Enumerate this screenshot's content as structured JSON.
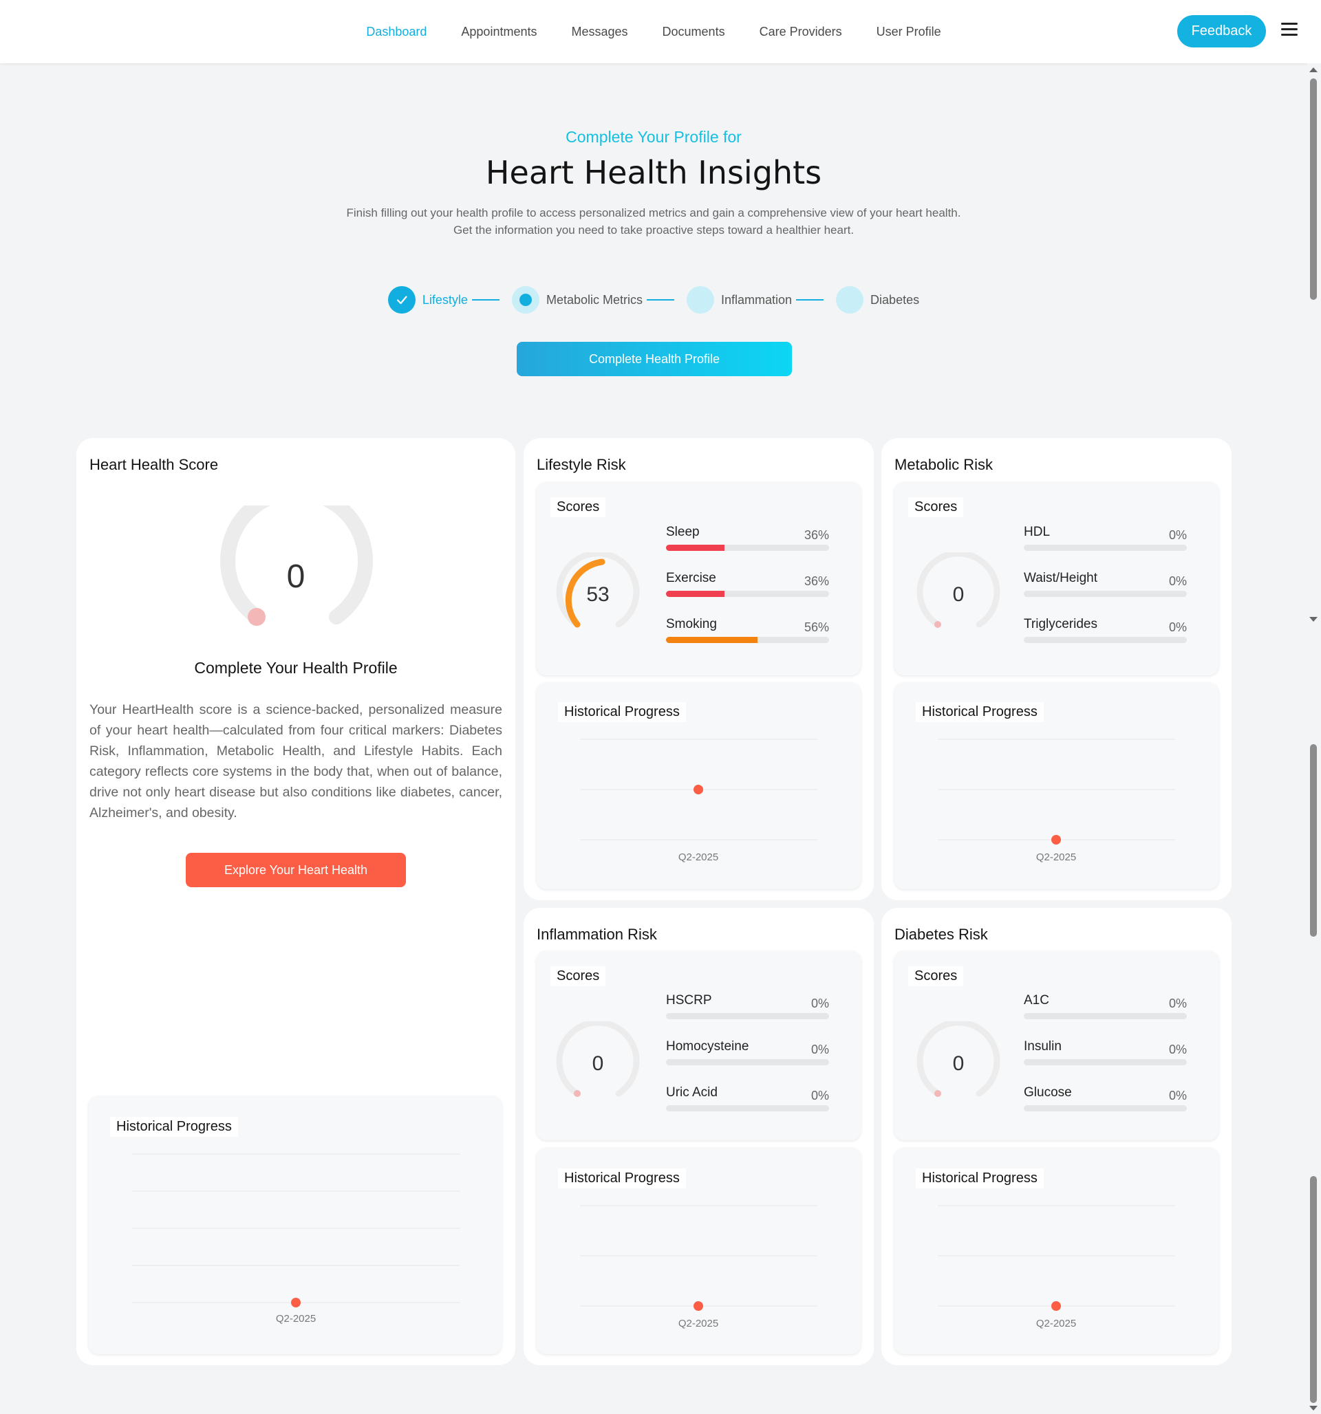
{
  "nav": {
    "items": [
      {
        "label": "Dashboard",
        "active": true
      },
      {
        "label": "Appointments",
        "active": false
      },
      {
        "label": "Messages",
        "active": false
      },
      {
        "label": "Documents",
        "active": false
      },
      {
        "label": "Care Providers",
        "active": false
      },
      {
        "label": "User Profile",
        "active": false
      }
    ],
    "feedback_label": "Feedback",
    "menu_icon": "hamburger-menu-icon"
  },
  "hero": {
    "subtitle": "Complete Your Profile for",
    "title": "Heart Health Insights",
    "description": "Finish filling out your health profile to access personalized metrics and gain a comprehensive view of your heart health. Get the information you need to take proactive steps toward a healthier heart.",
    "steps": [
      {
        "label": "Lifestyle",
        "state": "done"
      },
      {
        "label": "Metabolic Metrics",
        "state": "current"
      },
      {
        "label": "Inflammation",
        "state": "pending"
      },
      {
        "label": "Diabetes",
        "state": "pending"
      }
    ],
    "cta_label": "Complete Health Profile"
  },
  "colors": {
    "accent": "#13aee0",
    "red_bar": "#f0404f",
    "orange_bar": "#f4820f",
    "gauge_track": "#e9e9e9",
    "gauge_orange": "#f7931e",
    "dot": "#fb5e44",
    "cta_red": "#fb5e44"
  },
  "heart_score": {
    "title": "Heart Health Score",
    "score": "0",
    "subtitle": "Complete Your Health Profile",
    "description": "Your HeartHealth score is a science-backed, personalized measure of your heart health—calculated from four critical markers: Diabetes Risk, Inflammation, Metabolic Health, and Lifestyle Habits. Each category reflects core systems in the body that, when out of balance, drive not only heart disease but also conditions like diabetes, cancer, Alzheimer's, and obesity.",
    "button_label": "Explore Your Heart Health",
    "historical": {
      "label": "Historical Progress",
      "quarter": "Q2-2025"
    }
  },
  "lifestyle": {
    "title": "Lifestyle Risk",
    "scores_label": "Scores",
    "gauge_value": "53",
    "metrics": [
      {
        "name": "Sleep",
        "value": "36%",
        "fill": 0.36
      },
      {
        "name": "Exercise",
        "value": "36%",
        "fill": 0.36
      },
      {
        "name": "Smoking",
        "value": "56%",
        "fill": 0.56
      }
    ],
    "historical": {
      "label": "Historical Progress",
      "quarter": "Q2-2025"
    }
  },
  "metabolic": {
    "title": "Metabolic Risk",
    "scores_label": "Scores",
    "gauge_value": "0",
    "metrics": [
      {
        "name": "HDL",
        "value": "0%",
        "fill": 0
      },
      {
        "name": "Waist/Height",
        "value": "0%",
        "fill": 0
      },
      {
        "name": "Triglycerides",
        "value": "0%",
        "fill": 0
      }
    ],
    "historical": {
      "label": "Historical Progress",
      "quarter": "Q2-2025"
    }
  },
  "inflammation": {
    "title": "Inflammation Risk",
    "scores_label": "Scores",
    "gauge_value": "0",
    "metrics": [
      {
        "name": "HSCRP",
        "value": "0%",
        "fill": 0
      },
      {
        "name": "Homocysteine",
        "value": "0%",
        "fill": 0
      },
      {
        "name": "Uric Acid",
        "value": "0%",
        "fill": 0
      }
    ],
    "historical": {
      "label": "Historical Progress",
      "quarter": "Q2-2025"
    }
  },
  "diabetes": {
    "title": "Diabetes Risk",
    "scores_label": "Scores",
    "gauge_value": "0",
    "metrics": [
      {
        "name": "A1C",
        "value": "0%",
        "fill": 0
      },
      {
        "name": "Insulin",
        "value": "0%",
        "fill": 0
      },
      {
        "name": "Glucose",
        "value": "0%",
        "fill": 0
      }
    ],
    "historical": {
      "label": "Historical Progress",
      "quarter": "Q2-2025"
    }
  }
}
